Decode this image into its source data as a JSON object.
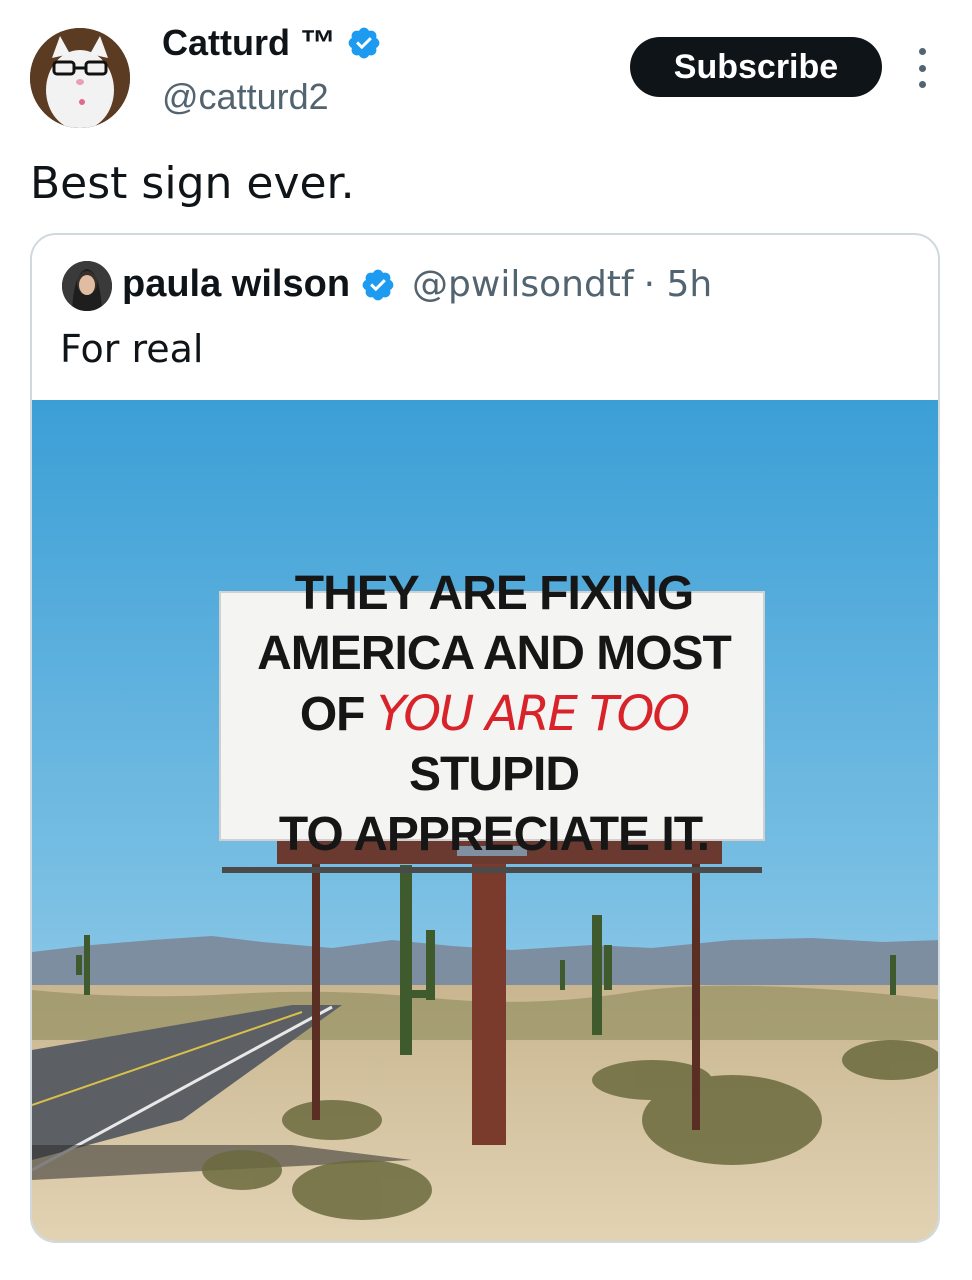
{
  "tweet": {
    "author_name": "Catturd ™",
    "author_handle": "@catturd2",
    "subscribe_label": "Subscribe",
    "text": "Best sign ever."
  },
  "quoted": {
    "author_name": "paula wilson",
    "author_handle": "@pwilsondtf",
    "time": "· 5h",
    "text": "For real",
    "image_sign": {
      "line1": "THEY ARE FIXING",
      "line2": "AMERICA AND MOST",
      "line3_a": "OF",
      "line3_red": "YOU ARE TOO",
      "line3_b": "STUPID",
      "line4": "TO APPRECIATE IT.",
      "red_color": "#d8232a"
    }
  },
  "colors": {
    "verified": "#1d9bf0",
    "text_primary": "#0f1419",
    "text_secondary": "#536471"
  },
  "icons": [
    "verified-badge-icon",
    "more-options-icon"
  ]
}
